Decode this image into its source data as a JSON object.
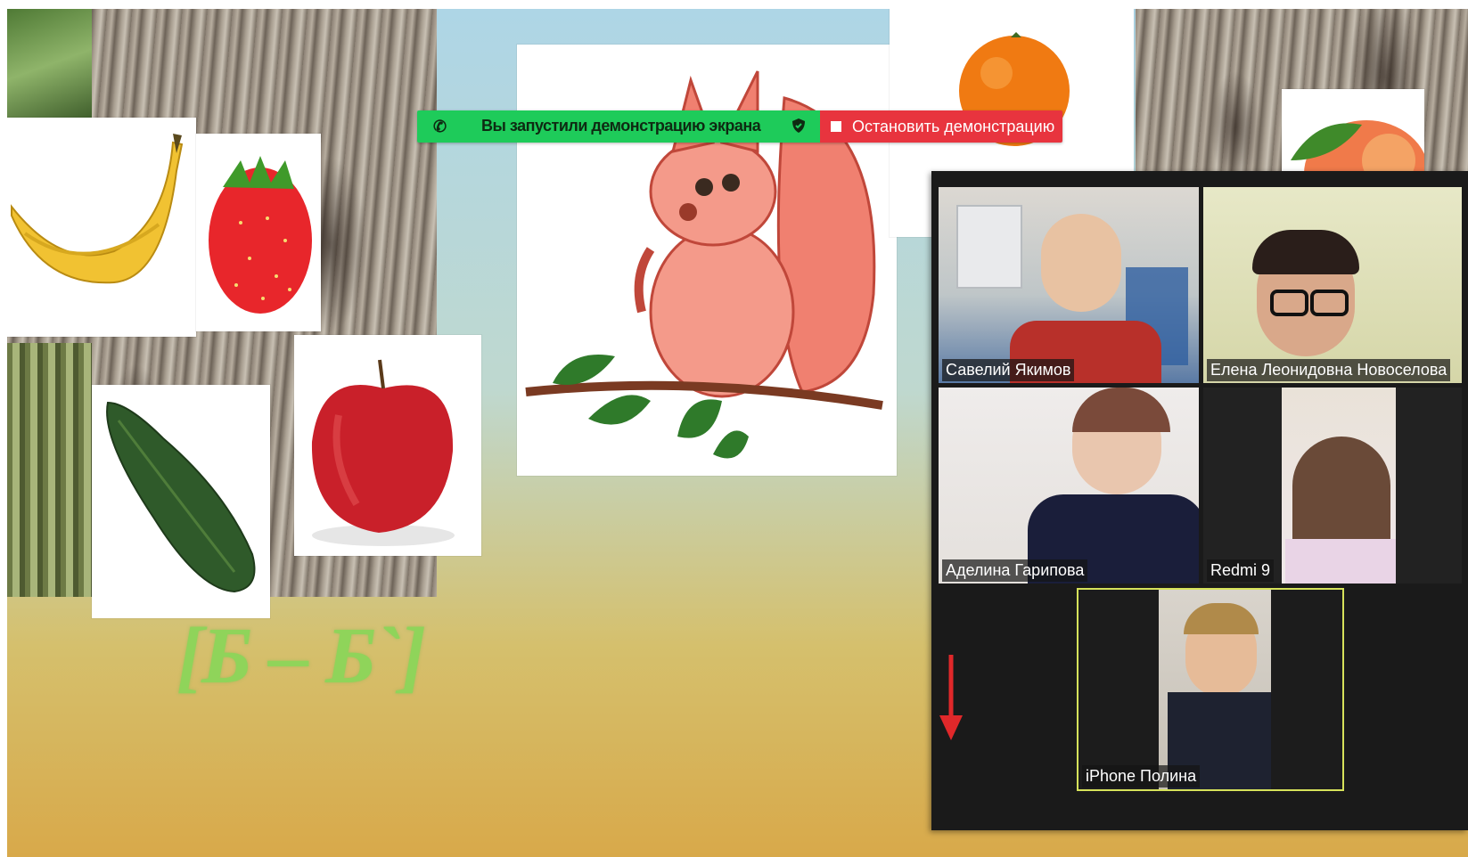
{
  "slide": {
    "sound_label": "[Б – Б`]"
  },
  "share_bar": {
    "message": "Вы запустили демонстрацию экрана",
    "stop_label": "Остановить демонстрацию"
  },
  "gallery": {
    "participants": [
      {
        "name": "Савелий Якимов"
      },
      {
        "name": "Елена Леонидовна Новоселова"
      },
      {
        "name": "Аделина Гарипова"
      },
      {
        "name": "Redmi 9"
      },
      {
        "name": "iPhone Полина"
      }
    ]
  },
  "colors": {
    "share_green": "#1ecb5a",
    "stop_red": "#e8343e",
    "active_speaker_border": "#d6e25a",
    "sound_label": "#8fd45a"
  }
}
